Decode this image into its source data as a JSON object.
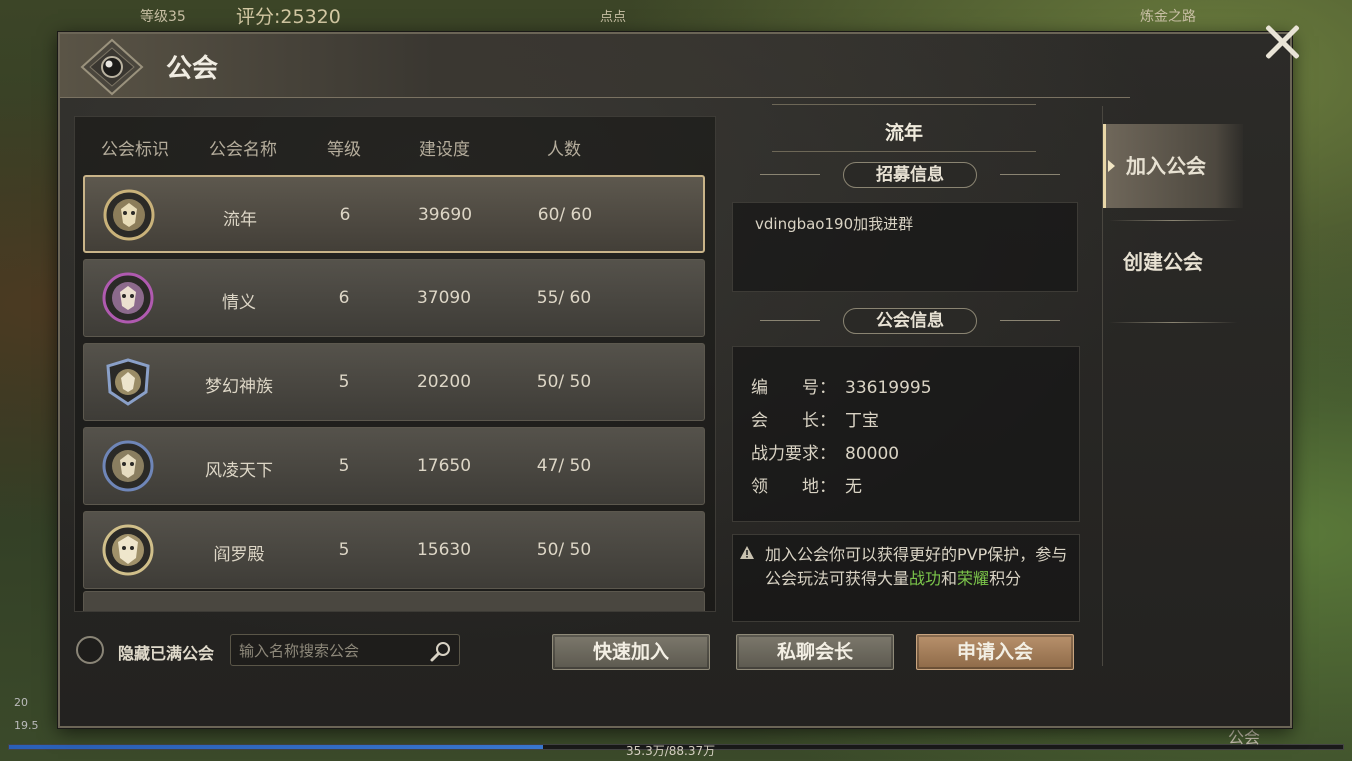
{
  "hud": {
    "level": "等级35",
    "score": "评分:25320",
    "player": "点点",
    "quest": "炼金之路",
    "exp_text": "35.3万/88.37万",
    "exp_progress": 0.4,
    "bottom_label": "公会",
    "device_time": "20",
    "device_net": "19.5"
  },
  "window": {
    "title": "公会"
  },
  "list": {
    "headers": [
      "公会标识",
      "公会名称",
      "等级",
      "建设度",
      "人数"
    ],
    "rows": [
      {
        "name": "流年",
        "level": "6",
        "build": "39690",
        "members": "60/ 60",
        "badge_color": "#c9b27a"
      },
      {
        "name": "情义",
        "level": "6",
        "build": "37090",
        "members": "55/ 60",
        "badge_color": "#b05ab0"
      },
      {
        "name": "梦幻神族",
        "level": "5",
        "build": "20200",
        "members": "50/ 50",
        "badge_color": "#8aa0c8"
      },
      {
        "name": "风凌天下",
        "level": "5",
        "build": "17650",
        "members": "47/ 50",
        "badge_color": "#6f86b8"
      },
      {
        "name": "阎罗殿",
        "level": "5",
        "build": "15630",
        "members": "50/ 50",
        "badge_color": "#d0bf8a"
      }
    ]
  },
  "controls": {
    "hide_full_label": "隐藏已满公会",
    "search_placeholder": "输入名称搜索公会",
    "quick_join": "快速加入",
    "private_chat": "私聊会长",
    "apply_join": "申请入会"
  },
  "detail": {
    "guild_name": "流年",
    "recruit_title": "招募信息",
    "recruit_text": "vdingbao190加我进群",
    "info_title": "公会信息",
    "fields": [
      {
        "key": "编　　号：",
        "value": "33619995"
      },
      {
        "key": "会　　长：",
        "value": "丁宝"
      },
      {
        "key": "战力要求：",
        "value": "80000"
      },
      {
        "key": "领　　地：",
        "value": "无"
      }
    ],
    "notice_part1": "加入公会你可以获得更好的PVP保护，参与公会玩法可获得大量",
    "notice_hl1": "战功",
    "notice_part2": "和",
    "notice_hl2": "荣耀",
    "notice_part3": "积分"
  },
  "tabs": {
    "join": "加入公会",
    "create": "创建公会"
  },
  "colors": {
    "highlight": "#7bc54a",
    "primary_button": "#a47e5a"
  }
}
